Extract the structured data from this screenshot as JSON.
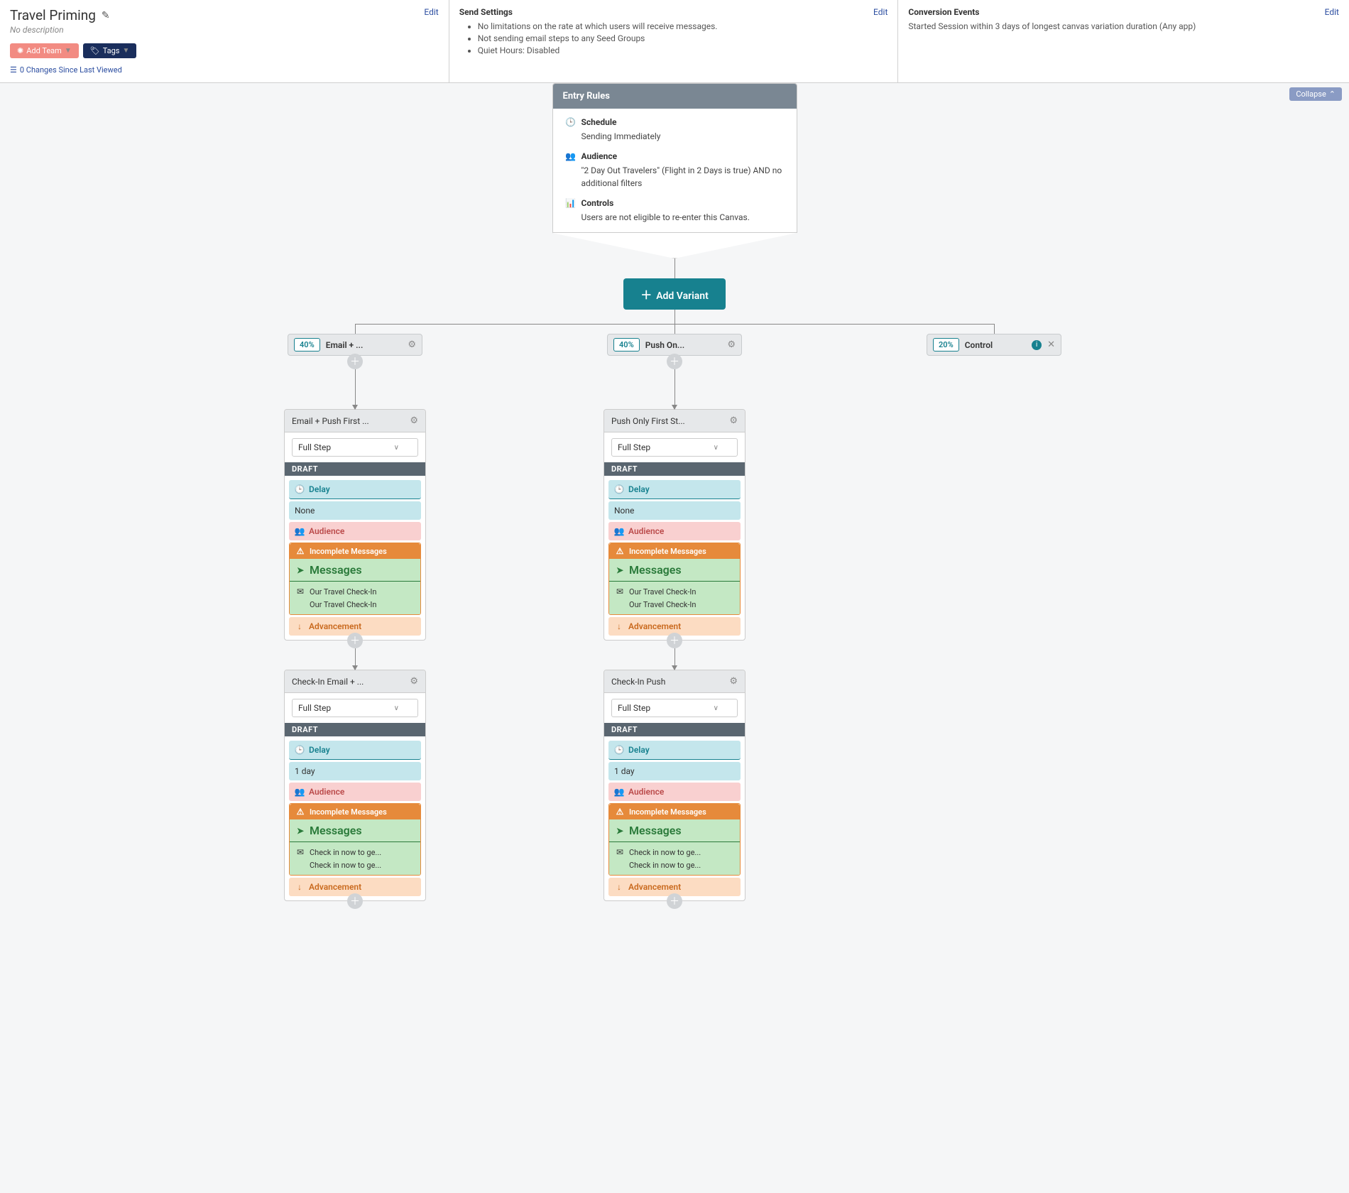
{
  "header": {
    "title": "Travel Priming",
    "no_description": "No description",
    "add_team": "Add Team",
    "tags": "Tags",
    "changes": "0 Changes Since Last Viewed",
    "edit": "Edit",
    "send_settings": {
      "heading": "Send Settings",
      "items": [
        "No limitations on the rate at which users will receive messages.",
        "Not sending email steps to any Seed Groups",
        "Quiet Hours: Disabled"
      ]
    },
    "conversion": {
      "heading": "Conversion Events",
      "body": "Started Session within 3 days of longest canvas variation duration (Any app)"
    }
  },
  "collapse": "Collapse",
  "entry": {
    "heading": "Entry Rules",
    "schedule_label": "Schedule",
    "schedule_val": "Sending Immediately",
    "audience_label": "Audience",
    "audience_val": "\"2 Day Out Travelers\" (Flight in 2 Days is true) AND no additional filters",
    "controls_label": "Controls",
    "controls_val": "Users are not eligible to re-enter this Canvas."
  },
  "add_variant": "Add Variant",
  "variants": {
    "a": {
      "pct": "40%",
      "name": "Email + ..."
    },
    "b": {
      "pct": "40%",
      "name": "Push On..."
    },
    "c": {
      "pct": "20%",
      "name": "Control"
    }
  },
  "step_labels": {
    "full_step": "Full Step",
    "draft": "DRAFT",
    "delay": "Delay",
    "none": "None",
    "one_day": "1 day",
    "audience": "Audience",
    "incomplete": "Incomplete Messages",
    "messages": "Messages",
    "advancement": "Advancement"
  },
  "steps": {
    "a1": {
      "title": "Email + Push First ...",
      "m1": "Our Travel Check-In",
      "m2": "Our Travel Check-In"
    },
    "a2": {
      "title": "Check-In Email + ...",
      "m1": "Check in now to ge...",
      "m2": "Check in now to ge..."
    },
    "b1": {
      "title": "Push Only First St...",
      "m1": "Our Travel Check-In",
      "m2": "Our Travel Check-In"
    },
    "b2": {
      "title": "Check-In Push",
      "m1": "Check in now to ge...",
      "m2": "Check in now to ge..."
    }
  }
}
